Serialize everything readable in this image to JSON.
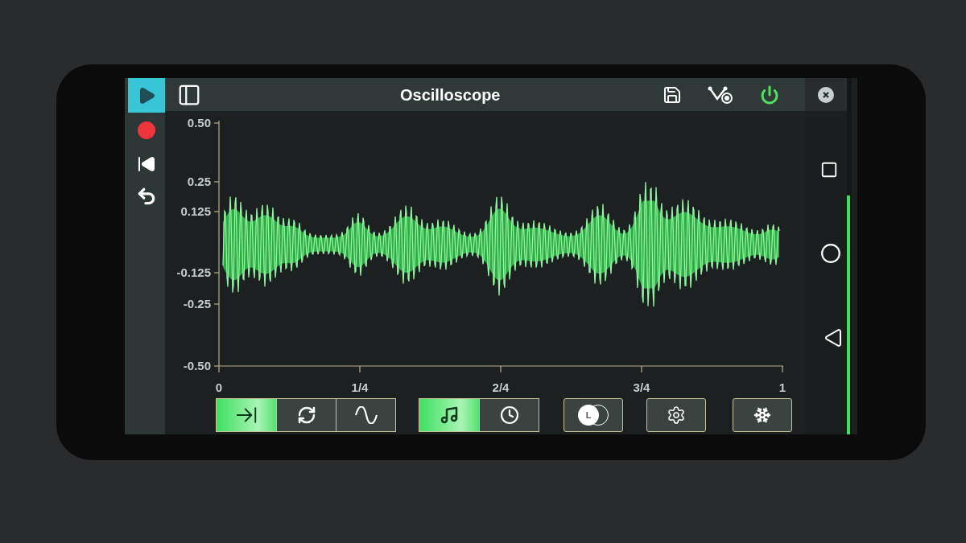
{
  "transport": [
    {
      "kind": "play",
      "selected": true
    },
    {
      "kind": "record",
      "selected": false
    },
    {
      "kind": "rewind",
      "selected": false
    },
    {
      "kind": "undo",
      "selected": false
    }
  ],
  "window": {
    "title": "Oscilloscope"
  },
  "plot": {
    "y_axis_labels": [
      "0.50",
      "0.25",
      "0.125",
      "-0.125",
      "-0.25",
      "-0.50"
    ],
    "x_axis_labels": [
      "0",
      "1/4",
      "2/4",
      "3/4",
      "1"
    ]
  },
  "controls": [
    {
      "kind": "segment",
      "buttons": [
        {
          "kind": "align",
          "selected": true
        },
        {
          "kind": "loop",
          "selected": false
        },
        {
          "kind": "sine",
          "selected": false
        }
      ]
    },
    {
      "kind": "segment",
      "buttons": [
        {
          "kind": "note",
          "selected": true
        },
        {
          "kind": "clock",
          "selected": false
        }
      ]
    },
    {
      "kind": "single",
      "buttons": [
        {
          "kind": "stereo",
          "label": "L"
        }
      ]
    },
    {
      "kind": "single",
      "buttons": [
        {
          "kind": "settings"
        }
      ]
    },
    {
      "kind": "single",
      "buttons": [
        {
          "kind": "freeze"
        }
      ]
    }
  ],
  "level_meter": {
    "level": 0.67
  }
}
